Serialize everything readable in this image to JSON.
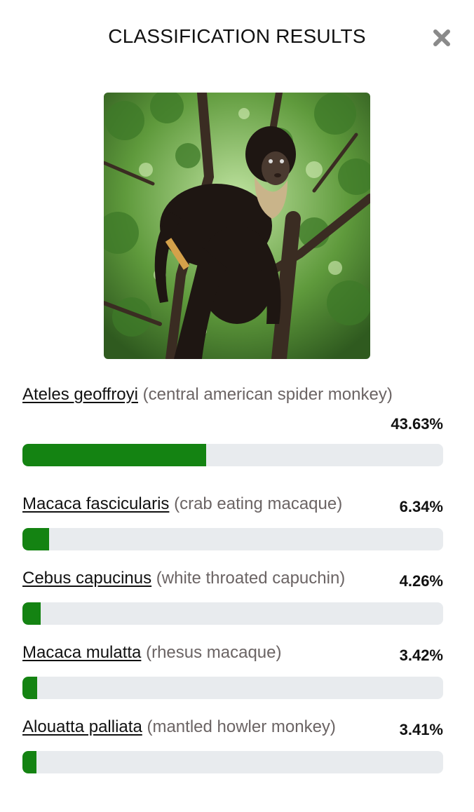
{
  "modal": {
    "title": "CLASSIFICATION RESULTS",
    "close_icon": "close-x-icon",
    "accent_color": "#148312",
    "track_color": "#e8ebee"
  },
  "results": [
    {
      "scientific_name": "Ateles geoffroyi",
      "common_name": "(central american spider monkey)",
      "percent_label": "43.63%",
      "percent": 43.63
    },
    {
      "scientific_name": "Macaca fascicularis",
      "common_name": "(crab eating macaque)",
      "percent_label": "6.34%",
      "percent": 6.34
    },
    {
      "scientific_name": "Cebus capucinus",
      "common_name": "(white throated capuchin)",
      "percent_label": "4.26%",
      "percent": 4.26
    },
    {
      "scientific_name": "Macaca mulatta",
      "common_name": "(rhesus macaque)",
      "percent_label": "3.42%",
      "percent": 3.42
    },
    {
      "scientific_name": "Alouatta palliata",
      "common_name": "(mantled howler monkey)",
      "percent_label": "3.41%",
      "percent": 3.41
    }
  ]
}
